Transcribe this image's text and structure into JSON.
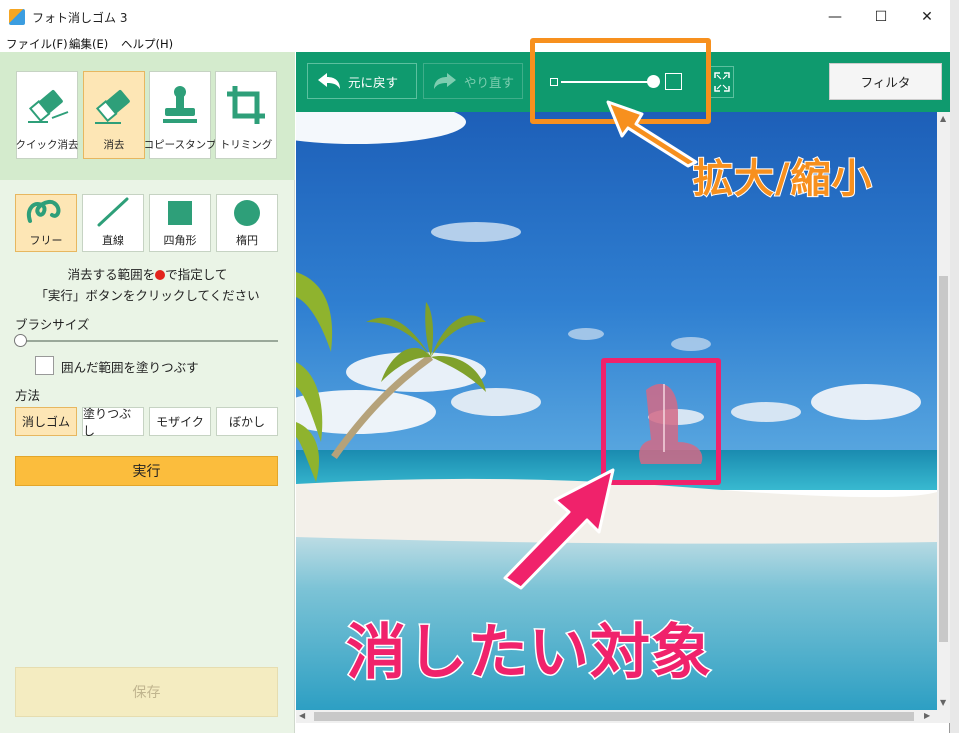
{
  "window": {
    "title": "フォト消しゴム 3",
    "minimize": "—",
    "maximize": "☐",
    "close": "✕"
  },
  "menu": [
    "ファイル(F)",
    "編集(E)",
    "ヘルプ(H)"
  ],
  "tools": [
    {
      "label": "クイック消去",
      "icon": "quick-erase-icon",
      "active": false
    },
    {
      "label": "消去",
      "icon": "eraser-icon",
      "active": true
    },
    {
      "label": "コピースタンプ",
      "icon": "stamp-icon",
      "active": false
    },
    {
      "label": "トリミング",
      "icon": "crop-icon",
      "active": false
    }
  ],
  "shapes": [
    {
      "label": "フリー",
      "icon": "freehand-icon",
      "active": true
    },
    {
      "label": "直線",
      "icon": "line-icon",
      "active": false
    },
    {
      "label": "四角形",
      "icon": "rectangle-icon",
      "active": false
    },
    {
      "label": "楕円",
      "icon": "ellipse-icon",
      "active": false
    }
  ],
  "instructions": {
    "line1_before": "消去する範囲を",
    "line1_after": "で指定して",
    "line2": "「実行」ボタンをクリックしてください"
  },
  "brush": {
    "label": "ブラシサイズ",
    "value": 0
  },
  "fill_option": {
    "label": "囲んだ範囲を塗りつぶす",
    "checked": false
  },
  "method": {
    "label": "方法",
    "options": [
      {
        "label": "消しゴム",
        "active": true
      },
      {
        "label": "塗りつぶし",
        "active": false
      },
      {
        "label": "モザイク",
        "active": false
      },
      {
        "label": "ぼかし",
        "active": false
      }
    ]
  },
  "run_label": "実行",
  "save_label": "保存",
  "toolbar": {
    "undo_label": "元に戻す",
    "redo_label": "やり直す",
    "filter_label": "フィルタ",
    "zoom_level": 1.0
  },
  "annotations": {
    "zoom_caption": "拡大/縮小",
    "target_caption": "消したい対象"
  },
  "colors": {
    "accent_green": "#0f9a6e",
    "active_orange": "#fde6b5",
    "run_yellow": "#fbbd3d",
    "annotation_orange": "#f7901e",
    "annotation_pink": "#f0226b"
  }
}
